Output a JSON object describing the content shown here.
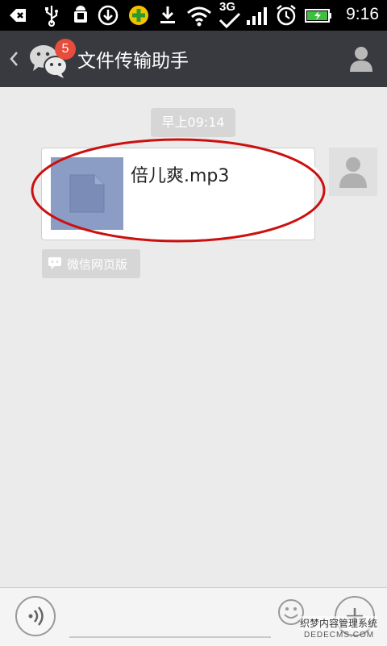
{
  "status_bar": {
    "time": "9:16",
    "network": "3G",
    "icons": [
      "back-notification-icon",
      "usb-icon",
      "android-debug-icon",
      "download-arrow-icon",
      "security-app-icon",
      "download-icon",
      "wifi-icon",
      "3g-signal-icon",
      "signal-bars-icon",
      "alarm-icon",
      "battery-charging-icon"
    ]
  },
  "header": {
    "title": "文件传输助手",
    "unread_badge": "5"
  },
  "chat": {
    "timestamp": "早上09:14",
    "message": {
      "file_name": "倍儿爽.mp3"
    },
    "source_label": "微信网页版"
  },
  "colors": {
    "titlebar": "#393a3f",
    "badge": "#e74c3c",
    "file_thumb": "#8b9cc5",
    "highlight": "#cc1010"
  },
  "watermark": {
    "line1": "织梦内容管理系统",
    "line2": "DEDECMS.COM"
  }
}
